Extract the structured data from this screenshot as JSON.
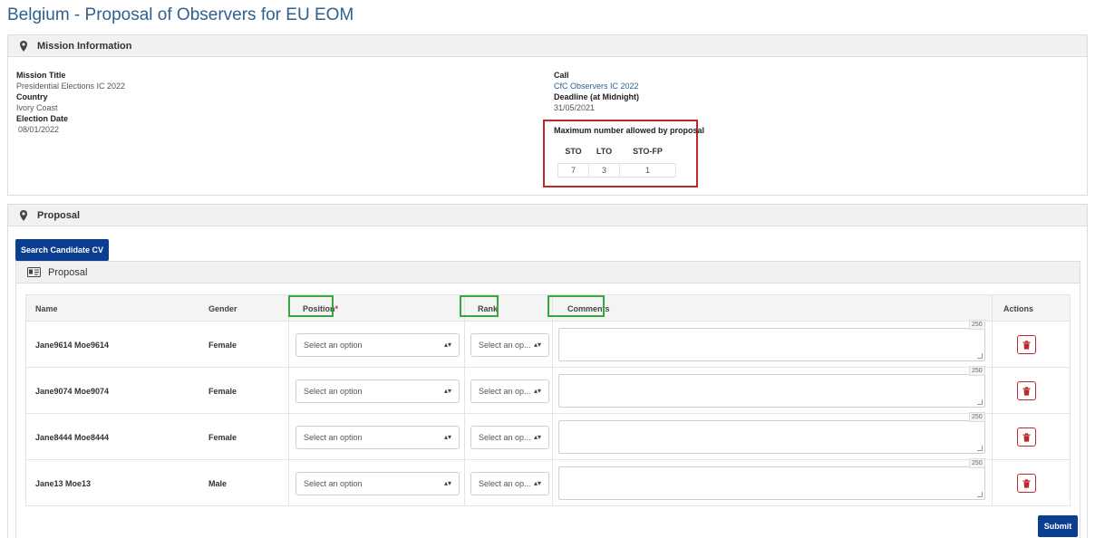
{
  "page": {
    "title": "Belgium - Proposal of Observers for EU EOM"
  },
  "mission": {
    "header": "Mission Information",
    "mission_title_label": "Mission Title",
    "mission_title_value": "Presidential Elections IC 2022",
    "country_label": "Country",
    "country_value": "Ivory Coast",
    "election_date_label": "Election Date",
    "election_date_value": "08/01/2022",
    "call_label": "Call",
    "call_value": "CfC Observers IC 2022",
    "deadline_label": "Deadline (at Midnight)",
    "deadline_value": "31/05/2021",
    "max_label": "Maximum number allowed by proposal",
    "max_table": {
      "headers": [
        "STO",
        "LTO",
        "STO-FP"
      ],
      "values": [
        "7",
        "3",
        "1"
      ]
    }
  },
  "proposal": {
    "header": "Proposal",
    "search_button": "Search Candidate CV",
    "inner_header": "Proposal",
    "columns": {
      "name": "Name",
      "gender": "Gender",
      "position": "Position",
      "position_required": "*",
      "rank": "Rank",
      "comments": "Comments",
      "actions": "Actions"
    },
    "rows": [
      {
        "name": "Jane9614 Moe9614",
        "gender": "Female",
        "position": "Select an option",
        "rank": "Select an op...",
        "counter": "250"
      },
      {
        "name": "Jane9074 Moe9074",
        "gender": "Female",
        "position": "Select an option",
        "rank": "Select an op...",
        "counter": "250"
      },
      {
        "name": "Jane8444 Moe8444",
        "gender": "Female",
        "position": "Select an option",
        "rank": "Select an op...",
        "counter": "250"
      },
      {
        "name": "Jane13 Moe13",
        "gender": "Male",
        "position": "Select an option",
        "rank": "Select an op...",
        "counter": "250"
      }
    ],
    "submit_button": "Submit"
  },
  "colors": {
    "accent": "#0b3d91",
    "highlight_red": "#c0272d",
    "highlight_green": "#3aa641",
    "title": "#2f5f8f"
  },
  "icons": {
    "panel": "map-pin-icon",
    "card": "id-card-icon",
    "delete": "trash-icon",
    "select": "caret-updown-icon"
  }
}
